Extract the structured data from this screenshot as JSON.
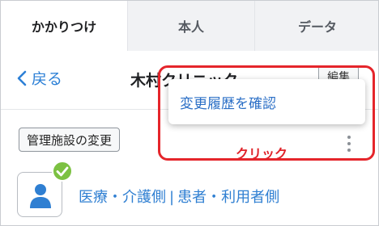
{
  "tabs": [
    {
      "label": "かかりつけ",
      "active": true
    },
    {
      "label": "本人",
      "active": false
    },
    {
      "label": "データ",
      "active": false
    }
  ],
  "header": {
    "back_label": "戻る",
    "clinic_name": "木村クリニック",
    "edit_label": "編集"
  },
  "popup": {
    "item_label": "変更履歴を確認"
  },
  "annotation": {
    "click_label": "クリック"
  },
  "manage_button_label": "管理施設の変更",
  "links": {
    "medical_label": "医療・介護側",
    "separator": "|",
    "patient_label": "患者・利用者側"
  },
  "colors": {
    "accent_blue": "#2d80d6",
    "highlight_red": "#e5252b",
    "check_green": "#7cc142"
  },
  "icons": [
    "chevron-left-icon",
    "user-icon",
    "check-badge-icon",
    "kebab-menu-icon"
  ]
}
